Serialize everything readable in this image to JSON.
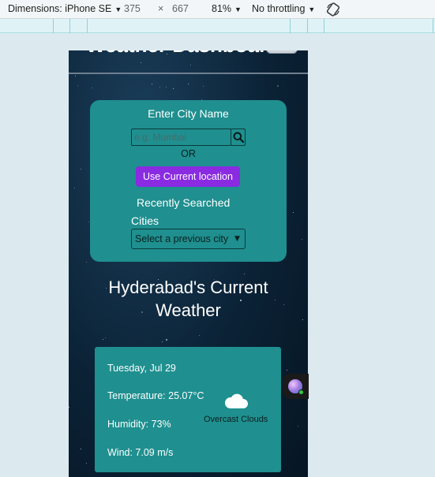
{
  "devtools": {
    "dimensions_label": "Dimensions: iPhone SE",
    "width": "375",
    "times": "×",
    "height": "667",
    "zoom": "81%",
    "throttling": "No throttling",
    "rotate_icon": "rotate-icon"
  },
  "header": {
    "title": "Weather Dashboard"
  },
  "search": {
    "heading": "Enter City Name",
    "placeholder": "e.g. Mumbai",
    "search_icon": "search-icon",
    "or_label": "OR",
    "location_button": "Use Current location",
    "recent_line1": "Recently Searched",
    "recent_line2": "Cities",
    "select_selected": "Select a previous city"
  },
  "current": {
    "heading_line1": "Hyderabad's Current",
    "heading_line2": "Weather",
    "date": "Tuesday, Jul 29",
    "temperature": "Temperature: 25.07°C",
    "humidity": "Humidity: 73%",
    "wind": "Wind: 7.09 m/s",
    "condition": "Overcast Clouds",
    "condition_icon": "cloud-icon"
  },
  "colors": {
    "card": "#1f8f8f",
    "button": "#8a2be2",
    "page_bg": "#dceaf0",
    "night_sky": "#0b2236"
  }
}
